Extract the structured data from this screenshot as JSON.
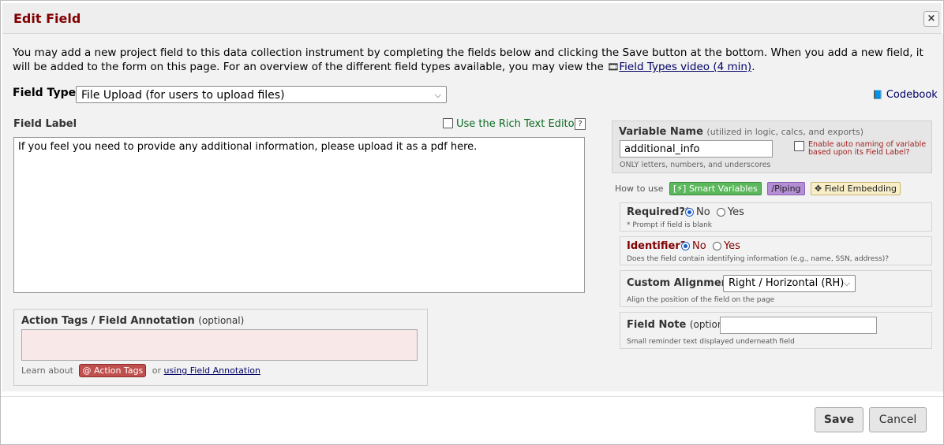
{
  "dialog": {
    "title": "Edit Field",
    "close_label": "×"
  },
  "intro": {
    "text": "You may add a new project field to this data collection instrument by completing the fields below and clicking the Save button at the bottom. When you add a new field, it will be added to the form on this page. For an overview of the different field types available, you may view the",
    "video_link": "Field Types video (4 min)",
    "period": "."
  },
  "field_type": {
    "label": "Field Type:",
    "selected": "File Upload (for users to upload files)"
  },
  "codebook": {
    "label": "Codebook"
  },
  "field_label": {
    "label": "Field Label",
    "rich_text_label": "Use the Rich Text Editor",
    "help": "?",
    "value": "If you feel you need to provide any additional information, please upload it as a pdf here."
  },
  "action_tags": {
    "title": "Action Tags / Field Annotation",
    "optional": "(optional)",
    "learn_about": "Learn about",
    "button": "@ Action Tags",
    "or": "or",
    "annotation_link": "using Field Annotation"
  },
  "variable": {
    "label": "Variable Name",
    "hint": "(utilized in logic, calcs, and exports)",
    "value": "additional_info",
    "only_letters": "ONLY letters, numbers, and underscores",
    "auto_naming": "Enable auto naming of variable based upon its Field Label?"
  },
  "how_to": {
    "label": "How to use",
    "smart": "[⚡] Smart Variables",
    "piping": "Piping",
    "embedding": "Field Embedding"
  },
  "required": {
    "label": "Required?*",
    "no": "No",
    "yes": "Yes",
    "selected": "No",
    "hint": "* Prompt if field is blank"
  },
  "identifier": {
    "label": "Identifier?",
    "no": "No",
    "yes": "Yes",
    "selected": "No",
    "hint": "Does the field contain identifying information (e.g., name, SSN, address)?"
  },
  "alignment": {
    "label": "Custom Alignment",
    "selected": "Right / Horizontal (RH)",
    "hint": "Align the position of the field on the page"
  },
  "field_note": {
    "label": "Field Note",
    "optional": "(optional)",
    "value": "",
    "hint": "Small reminder text displayed underneath field"
  },
  "footer": {
    "save": "Save",
    "cancel": "Cancel"
  },
  "colors": {
    "title": "#800000",
    "identifier": "#800000",
    "link": "#000066",
    "rte": "#0b6b22",
    "action_tag_bg": "#f9e8e8"
  }
}
